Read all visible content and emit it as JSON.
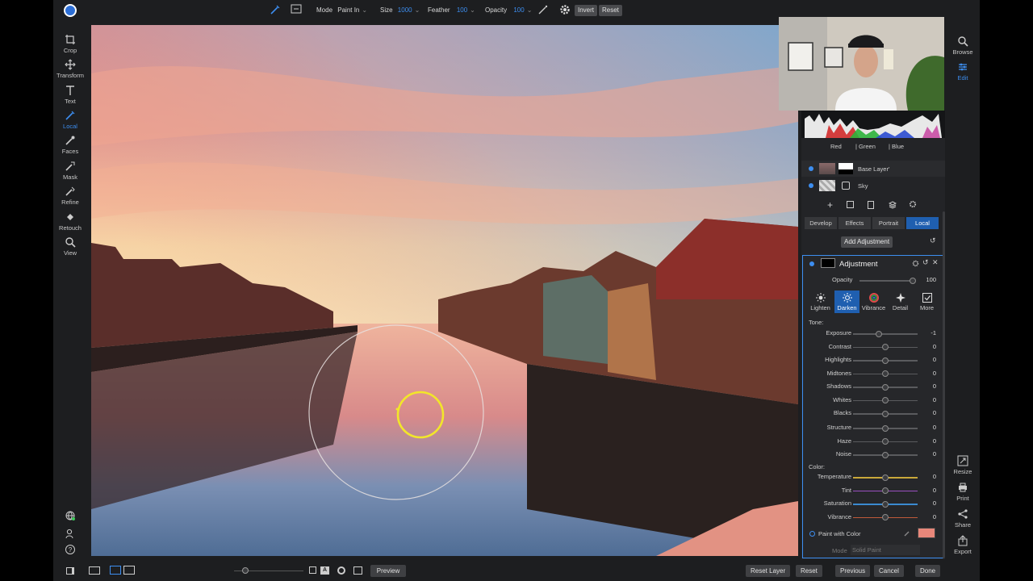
{
  "toolbar": {
    "mode_label": "Mode",
    "mode_value": "Paint In",
    "size_label": "Size",
    "size_value": "1000",
    "feather_label": "Feather",
    "feather_value": "100",
    "opacity_label": "Opacity",
    "opacity_value": "100",
    "invert_label": "Invert",
    "reset_label": "Reset"
  },
  "left_tools": [
    {
      "label": "Crop",
      "icon": "crop-icon"
    },
    {
      "label": "Transform",
      "icon": "transform-icon"
    },
    {
      "label": "Text",
      "icon": "text-icon"
    },
    {
      "label": "Local",
      "icon": "brush-icon"
    },
    {
      "label": "Faces",
      "icon": "faces-icon"
    },
    {
      "label": "Mask",
      "icon": "mask-icon"
    },
    {
      "label": "Refine",
      "icon": "refine-icon"
    },
    {
      "label": "Retouch",
      "icon": "retouch-icon"
    },
    {
      "label": "View",
      "icon": "view-icon"
    }
  ],
  "right_nav": [
    {
      "label": "Browse",
      "icon": "browse-icon"
    },
    {
      "label": "Edit",
      "icon": "edit-icon"
    },
    {
      "label": "Resize",
      "icon": "resize-icon"
    },
    {
      "label": "Print",
      "icon": "print-icon"
    },
    {
      "label": "Share",
      "icon": "share-icon"
    },
    {
      "label": "Export",
      "icon": "export-icon"
    }
  ],
  "histogram": {
    "red": "Red",
    "green": "| Green",
    "blue": "| Blue"
  },
  "layers": [
    {
      "name": "Base Layer'"
    },
    {
      "name": "Sky"
    }
  ],
  "tabs": [
    {
      "label": "Develop"
    },
    {
      "label": "Effects"
    },
    {
      "label": "Portrait"
    },
    {
      "label": "Local"
    }
  ],
  "add_adjustment": "Add Adjustment",
  "adjustment": {
    "title": "Adjustment",
    "opacity_label": "Opacity",
    "opacity_value": "100",
    "presets": [
      {
        "label": "Lighten",
        "icon": "sun-icon"
      },
      {
        "label": "Darken",
        "icon": "darken-icon"
      },
      {
        "label": "Vibrance",
        "icon": "vibrance-icon"
      },
      {
        "label": "Detail",
        "icon": "detail-icon"
      },
      {
        "label": "More",
        "icon": "more-icon"
      }
    ],
    "tone_label": "Tone:",
    "tone": [
      {
        "label": "Exposure",
        "value": "-1",
        "level": 0.4
      },
      {
        "label": "Contrast",
        "value": "0",
        "level": 0.5
      },
      {
        "label": "Highlights",
        "value": "0",
        "level": 0.5
      },
      {
        "label": "Midtones",
        "value": "0",
        "level": 0.5
      },
      {
        "label": "Shadows",
        "value": "0",
        "level": 0.5
      },
      {
        "label": "Whites",
        "value": "0",
        "level": 0.5
      },
      {
        "label": "Blacks",
        "value": "0",
        "level": 0.5
      }
    ],
    "detail": [
      {
        "label": "Structure",
        "value": "0",
        "level": 0.5
      },
      {
        "label": "Haze",
        "value": "0",
        "level": 0.5
      },
      {
        "label": "Noise",
        "value": "0",
        "level": 0.5
      }
    ],
    "color_label": "Color:",
    "color": [
      {
        "label": "Temperature",
        "value": "0",
        "level": 0.5,
        "track": "#c9a83a"
      },
      {
        "label": "Tint",
        "value": "0",
        "level": 0.5,
        "track": "#9a4fc0"
      },
      {
        "label": "Saturation",
        "value": "0",
        "level": 0.5,
        "track": "#3a8ad0"
      },
      {
        "label": "Vibrance",
        "value": "0",
        "level": 0.5,
        "track": "#c05a3a"
      }
    ],
    "paint_with_color": "Paint with Color",
    "paint_swatch": "#e8877a",
    "mode_label": "Mode",
    "mode_value": "Solid Paint"
  },
  "bottom": {
    "preview": "Preview",
    "reset_layer": "Reset Layer",
    "reset": "Reset",
    "previous": "Previous",
    "cancel": "Cancel",
    "done": "Done"
  },
  "colors": {
    "accent": "#3d8ef0",
    "brush": "#f2e62a"
  }
}
